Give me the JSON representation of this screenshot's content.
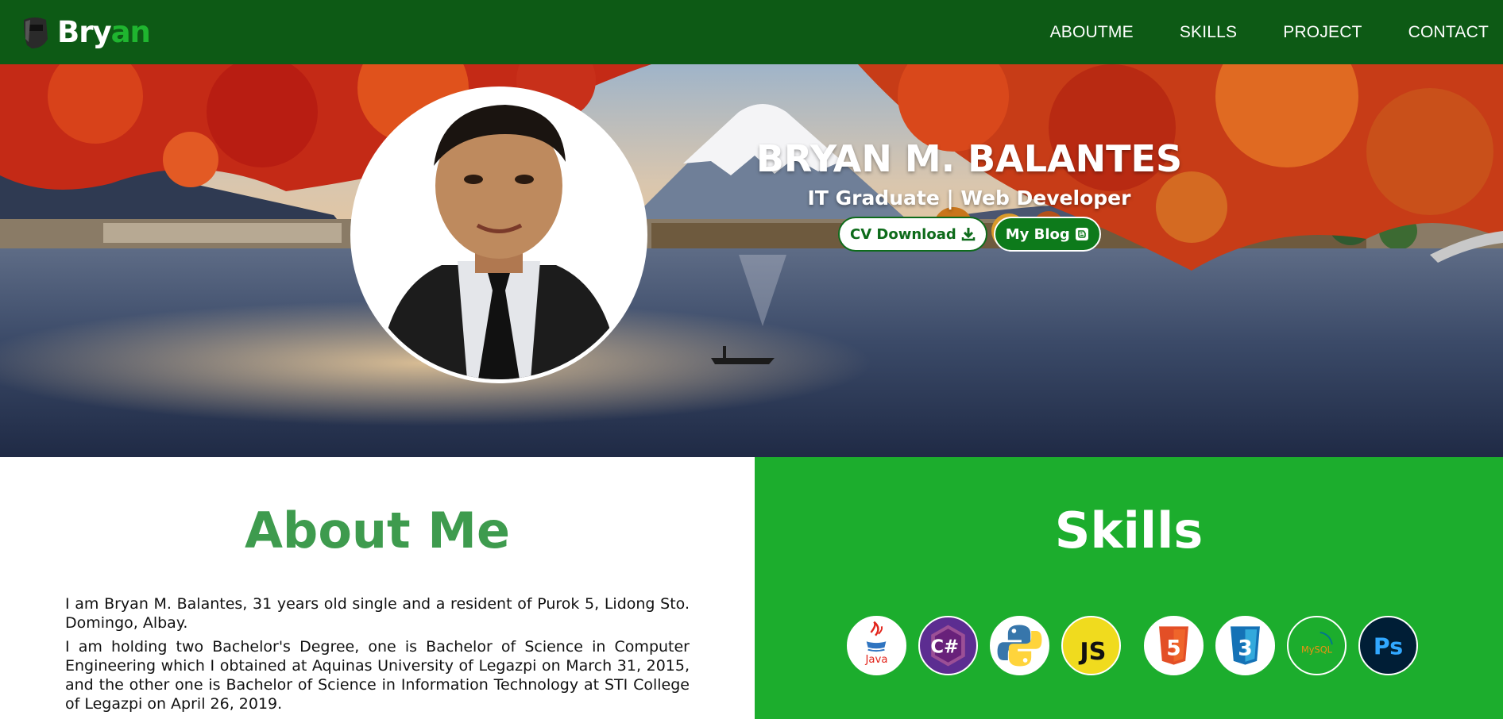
{
  "navbar": {
    "brand_prefix": "Bry",
    "brand_suffix": "an",
    "links": [
      "ABOUTME",
      "SKILLS",
      "PROJECT",
      "CONTACT"
    ]
  },
  "hero": {
    "name": "BRYAN M. BALANTES",
    "role": "IT Graduate | Web Developer",
    "cv_button": "CV Download",
    "blog_button": "My Blog"
  },
  "about": {
    "title": "About Me",
    "paragraphs": [
      "I am Bryan M. Balantes, 31 years old single and a resident of Purok 5, Lidong Sto. Domingo, Albay.",
      "I am holding two Bachelor's Degree, one is Bachelor of Science in Computer Engineering which I obtained at Aquinas University of Legazpi on March 31, 2015, and the other one is Bachelor of Science in Information Technology at STI College of Legazpi on April 26, 2019."
    ]
  },
  "skills": {
    "title": "Skills",
    "icons": [
      {
        "name": "java-icon",
        "label": "Java"
      },
      {
        "name": "csharp-icon",
        "label": "C#"
      },
      {
        "name": "python-icon",
        "label": ""
      },
      {
        "name": "javascript-icon",
        "label": "JS"
      },
      {
        "name": "html5-icon",
        "label": "5"
      },
      {
        "name": "css3-icon",
        "label": "3"
      },
      {
        "name": "mysql-icon",
        "label": "MySQL"
      },
      {
        "name": "photoshop-icon",
        "label": "Ps"
      }
    ]
  },
  "colors": {
    "navbar": "#0d5a15",
    "accent": "#1fb52f",
    "about_title": "#3e9b4e",
    "skills_bg": "#1cad2d"
  }
}
